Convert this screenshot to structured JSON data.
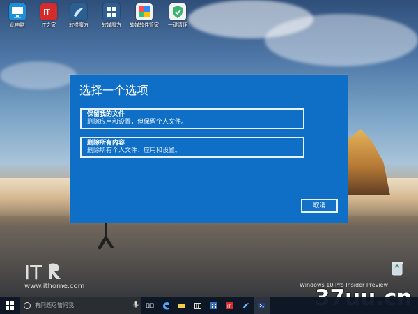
{
  "desktop": {
    "icons": [
      {
        "label": "此电脑"
      },
      {
        "label": "IT之家"
      },
      {
        "label": "软媒魔方"
      },
      {
        "label": "软媒魔方"
      },
      {
        "label": "软媒软件管家"
      },
      {
        "label": "一键清理"
      }
    ]
  },
  "dialog": {
    "title": "选择一个选项",
    "options": [
      {
        "title": "保留我的文件",
        "subtitle": "删除应用和设置，但保留个人文件。"
      },
      {
        "title": "删除所有内容",
        "subtitle": "删除所有个人文件、应用和设置。"
      }
    ],
    "cancel_label": "取消"
  },
  "watermark": {
    "url": "www.ithome.com",
    "build_text": "Windows 10 Pro Insider Preview",
    "brand_text": "37uu.cn"
  },
  "taskbar": {
    "search_placeholder": "有问题尽管问我",
    "icons": [
      "task-view-icon",
      "edge-icon",
      "file-explorer-icon",
      "store-icon",
      "mofang-icon",
      "ithome-icon",
      "app-icon",
      "powershell-icon"
    ]
  },
  "colors": {
    "dialog_bg": "#0f6fc6",
    "taskbar_bg": "#0c1625"
  }
}
